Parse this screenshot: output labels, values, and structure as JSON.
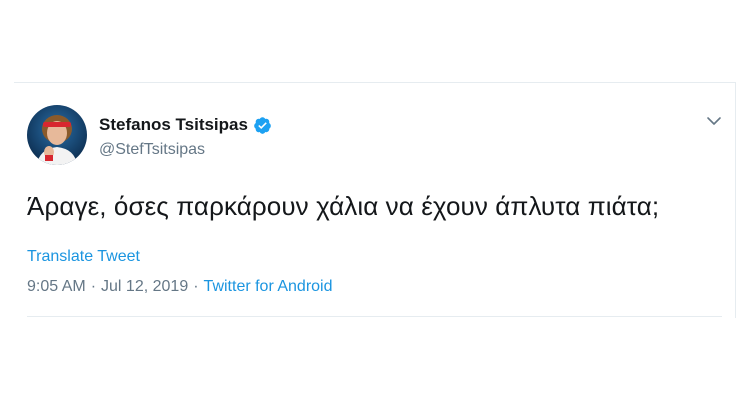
{
  "tweet": {
    "author": {
      "display_name": "Stefanos Tsitsipas",
      "handle": "@StefTsitsipas",
      "verified": true,
      "avatar_icon": "profile-avatar"
    },
    "text": "Άραγε, όσες παρκάρουν χάλια να έχουν άπλυτα πιάτα;",
    "translate_label": "Translate Tweet",
    "time": "9:05 AM",
    "date": "Jul 12, 2019",
    "separator": "·",
    "source": "Twitter for Android",
    "menu_icon": "chevron-down-icon"
  },
  "colors": {
    "link": "#1b95e0",
    "muted": "#657786",
    "text": "#14171a",
    "verified": "#1da1f2",
    "border": "#e6ecf0"
  }
}
